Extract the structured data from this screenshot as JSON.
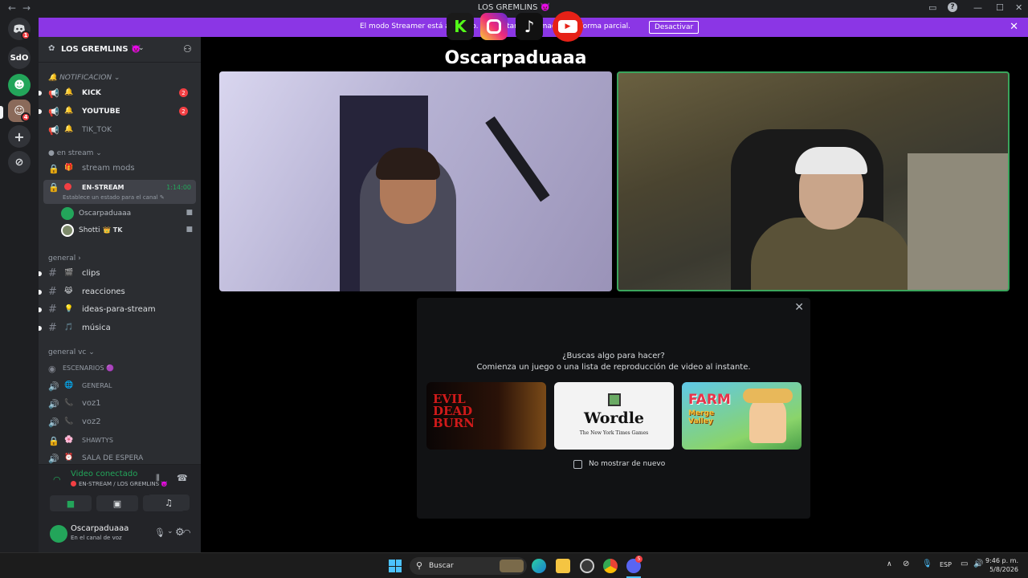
{
  "window": {
    "title": "LOS GREMLINS 👿",
    "back": "←",
    "forward": "→",
    "controls": [
      "▭",
      "?",
      "—",
      "☐",
      "✕"
    ]
  },
  "banner": {
    "text": "El modo Streamer está activado. Se ocultará información de forma parcial.",
    "button": "Desactivar",
    "close": "✕"
  },
  "rail": {
    "home_badge": "1",
    "sdo": "SdO",
    "server2_badge": "4",
    "add": "+",
    "explore": "⊘"
  },
  "sidebar": {
    "server_name": "LOS GREMLINS 👿",
    "categories": {
      "notificacion": "🔔 NOTIFICACION ⌄",
      "en_stream": "● en stream ⌄",
      "general": "general ›",
      "general_vc": "general vc ⌄"
    },
    "notif_channels": [
      {
        "icon": "📢",
        "emoji": "🔔",
        "name": "KICK",
        "badge": "2"
      },
      {
        "icon": "📢",
        "emoji": "🔔",
        "name": "YOUTUBE",
        "badge": "2"
      },
      {
        "icon": "📢",
        "emoji": "🔔",
        "name": "TIK_TOK",
        "badge": ""
      }
    ],
    "stream_mods": {
      "icon": "🔒",
      "emoji": "🎁",
      "name": "stream mods"
    },
    "en_stream_channel": {
      "name": "EN-STREAM",
      "time": "1:14:00",
      "status": "Establece un estado para el canal ✎"
    },
    "voice_users": [
      {
        "name": "Oscarpaduaaa",
        "extra": ""
      },
      {
        "name": "Shotti",
        "extra": "👑 TK"
      }
    ],
    "text_channels": [
      {
        "emoji": "🎬",
        "name": "clips"
      },
      {
        "emoji": "😹",
        "name": "reacciones"
      },
      {
        "emoji": "💡",
        "name": "ideas-para-stream"
      },
      {
        "emoji": "🎵",
        "name": "música"
      }
    ],
    "voice_channels": [
      {
        "icon": "◉",
        "emoji": "",
        "name": "ESCENARIOS 🟣"
      },
      {
        "icon": "🔊",
        "emoji": "🌐",
        "name": "GENERAL"
      },
      {
        "icon": "🔊",
        "emoji": "📞",
        "name": "voz1"
      },
      {
        "icon": "🔊",
        "emoji": "📞",
        "name": "voz2"
      },
      {
        "icon": "🔒",
        "emoji": "🌸",
        "name": "SHAWTYS"
      },
      {
        "icon": "🔊",
        "emoji": "⏰",
        "name": "SALA DE ESPERA"
      }
    ]
  },
  "voice_panel": {
    "status": "Video conectado",
    "location": "EN-STREAM / LOS GREMLINS 👿"
  },
  "user_panel": {
    "name": "Oscarpaduaaa",
    "status": "En el canal de voz"
  },
  "overlay": {
    "name": "Oscarpaduaaa",
    "kick": "K"
  },
  "modal": {
    "question": "¿Buscas algo para hacer?",
    "subtitle": "Comienza un juego o una lista de reproducción de video al instante.",
    "games": [
      {
        "title": "EVIL DEAD BURN",
        "caption": ""
      },
      {
        "title": "Wordle",
        "caption": "The New York Times Games"
      },
      {
        "title": "FARM",
        "caption": "Merge Valley"
      }
    ],
    "checkbox": "No mostrar de nuevo",
    "close": "✕"
  },
  "taskbar": {
    "search": "Buscar",
    "lang": "ESP",
    "time": "9:46 p. m.",
    "date": "5/8/2026",
    "discord_badge": "5"
  }
}
